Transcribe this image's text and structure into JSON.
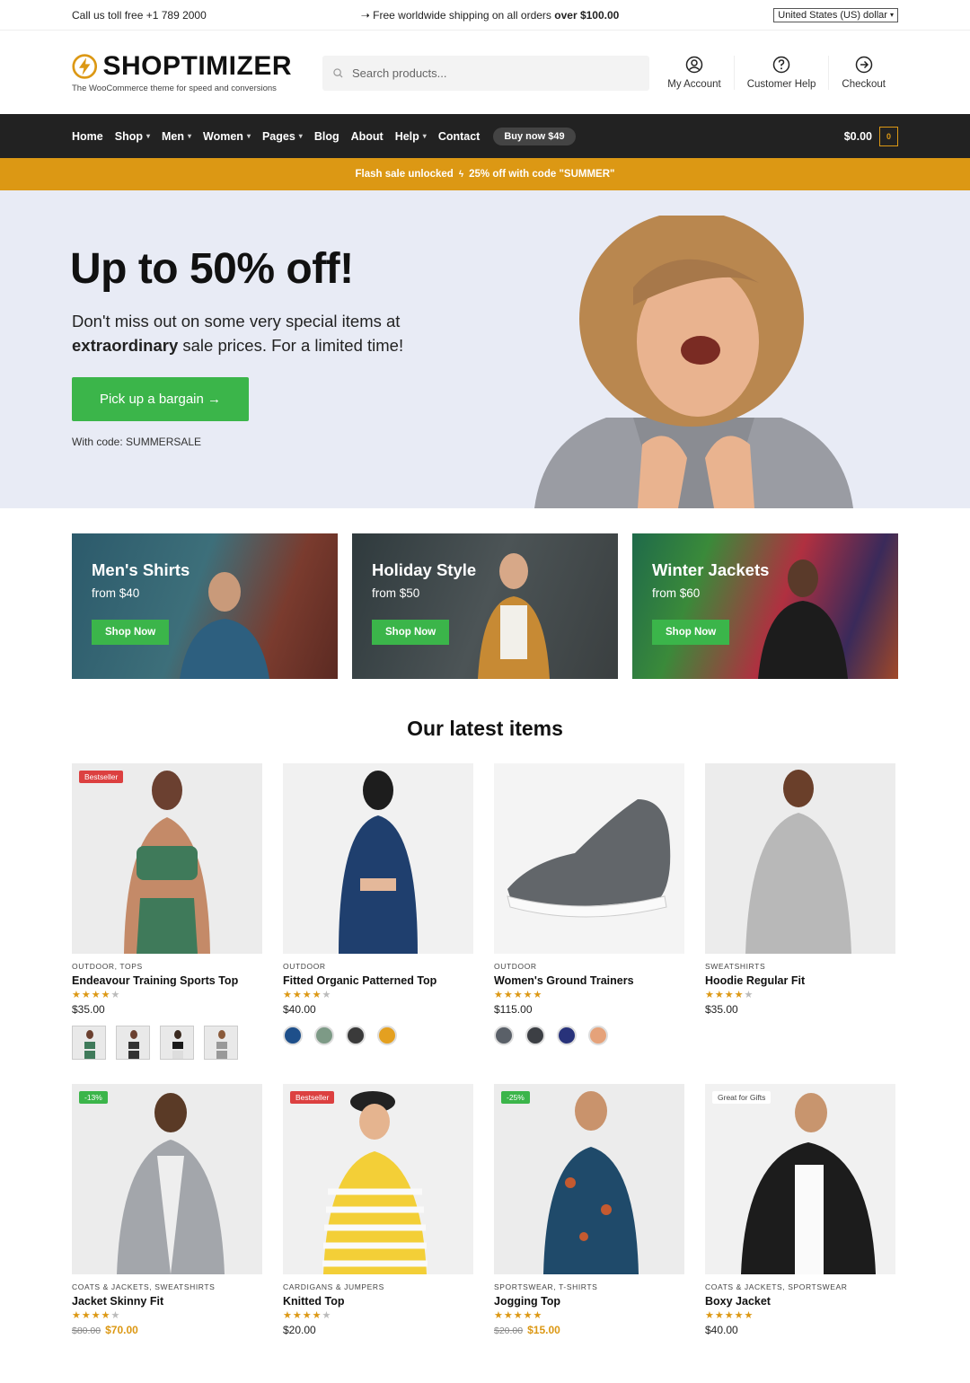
{
  "topbar": {
    "phone": "Call us toll free +1 789 2000",
    "shipping_prefix": "Free worldwide shipping on all orders",
    "shipping_bold": "over $100.00",
    "currency": "United States (US) dollar"
  },
  "header": {
    "logo": "SHOPTIMIZER",
    "tagline": "The WooCommerce theme for speed and conversions",
    "search_placeholder": "Search products...",
    "links": [
      "My Account",
      "Customer Help",
      "Checkout"
    ]
  },
  "nav": {
    "items": [
      "Home",
      "Shop",
      "Men",
      "Women",
      "Pages",
      "Blog",
      "About",
      "Help",
      "Contact"
    ],
    "has_dropdown": [
      false,
      true,
      true,
      true,
      true,
      false,
      false,
      true,
      false
    ],
    "buy_label": "Buy now $49",
    "cart_total": "$0.00",
    "cart_count": "0"
  },
  "flash": {
    "text": "Flash sale unlocked",
    "offer": "25% off with code \"SUMMER\""
  },
  "hero": {
    "title": "Up to 50% off!",
    "text_1": "Don't miss out on some very special items at",
    "text_bold": "extraordinary",
    "text_2": "sale prices. For a limited time!",
    "button": "Pick up a bargain →",
    "code": "With code: SUMMERSALE"
  },
  "categories": [
    {
      "title": "Men's Shirts",
      "from": "from $40",
      "button": "Shop Now"
    },
    {
      "title": "Holiday Style",
      "from": "from $50",
      "button": "Shop Now"
    },
    {
      "title": "Winter Jackets",
      "from": "from $60",
      "button": "Shop Now"
    }
  ],
  "latest": {
    "title": "Our latest items",
    "products": [
      {
        "badge": "Bestseller",
        "category": "OUTDOOR, TOPS",
        "name": "Endeavour Training Sports Top",
        "rating": 4,
        "price": "$35.00"
      },
      {
        "badge": "",
        "category": "OUTDOOR",
        "name": "Fitted Organic Patterned Top",
        "rating": 4,
        "price": "$40.00",
        "swatches": [
          "#1e4f8a",
          "#7d9a86",
          "#3a3a3a",
          "#e4a020"
        ]
      },
      {
        "badge": "",
        "category": "OUTDOOR",
        "name": "Women's Ground Trainers",
        "rating": 5,
        "price": "$115.00",
        "swatches": [
          "#5a6068",
          "#3c3f44",
          "#28327a",
          "#e5a27a"
        ]
      },
      {
        "badge": "",
        "category": "SWEATSHIRTS",
        "name": "Hoodie Regular Fit",
        "rating": 4,
        "price": "$35.00"
      },
      {
        "badge": "-13%",
        "category": "COATS & JACKETS, SWEATSHIRTS",
        "name": "Jacket Skinny Fit",
        "rating": 4,
        "old_price": "$80.00",
        "price": "$70.00"
      },
      {
        "badge": "Bestseller",
        "category": "CARDIGANS & JUMPERS",
        "name": "Knitted Top",
        "rating": 4,
        "price": "$20.00"
      },
      {
        "badge": "-25%",
        "category": "SPORTSWEAR, T-SHIRTS",
        "name": "Jogging Top",
        "rating": 5,
        "old_price": "$20.00",
        "price": "$15.00"
      },
      {
        "badge": "Great for Gifts",
        "category": "COATS & JACKETS, SPORTSWEAR",
        "name": "Boxy Jacket",
        "rating": 5,
        "price": "$40.00"
      }
    ]
  },
  "colors": {
    "accent": "#dc9814",
    "green": "#3bb54a",
    "nav": "#222222",
    "hero_bg": "#e8ebf5"
  }
}
